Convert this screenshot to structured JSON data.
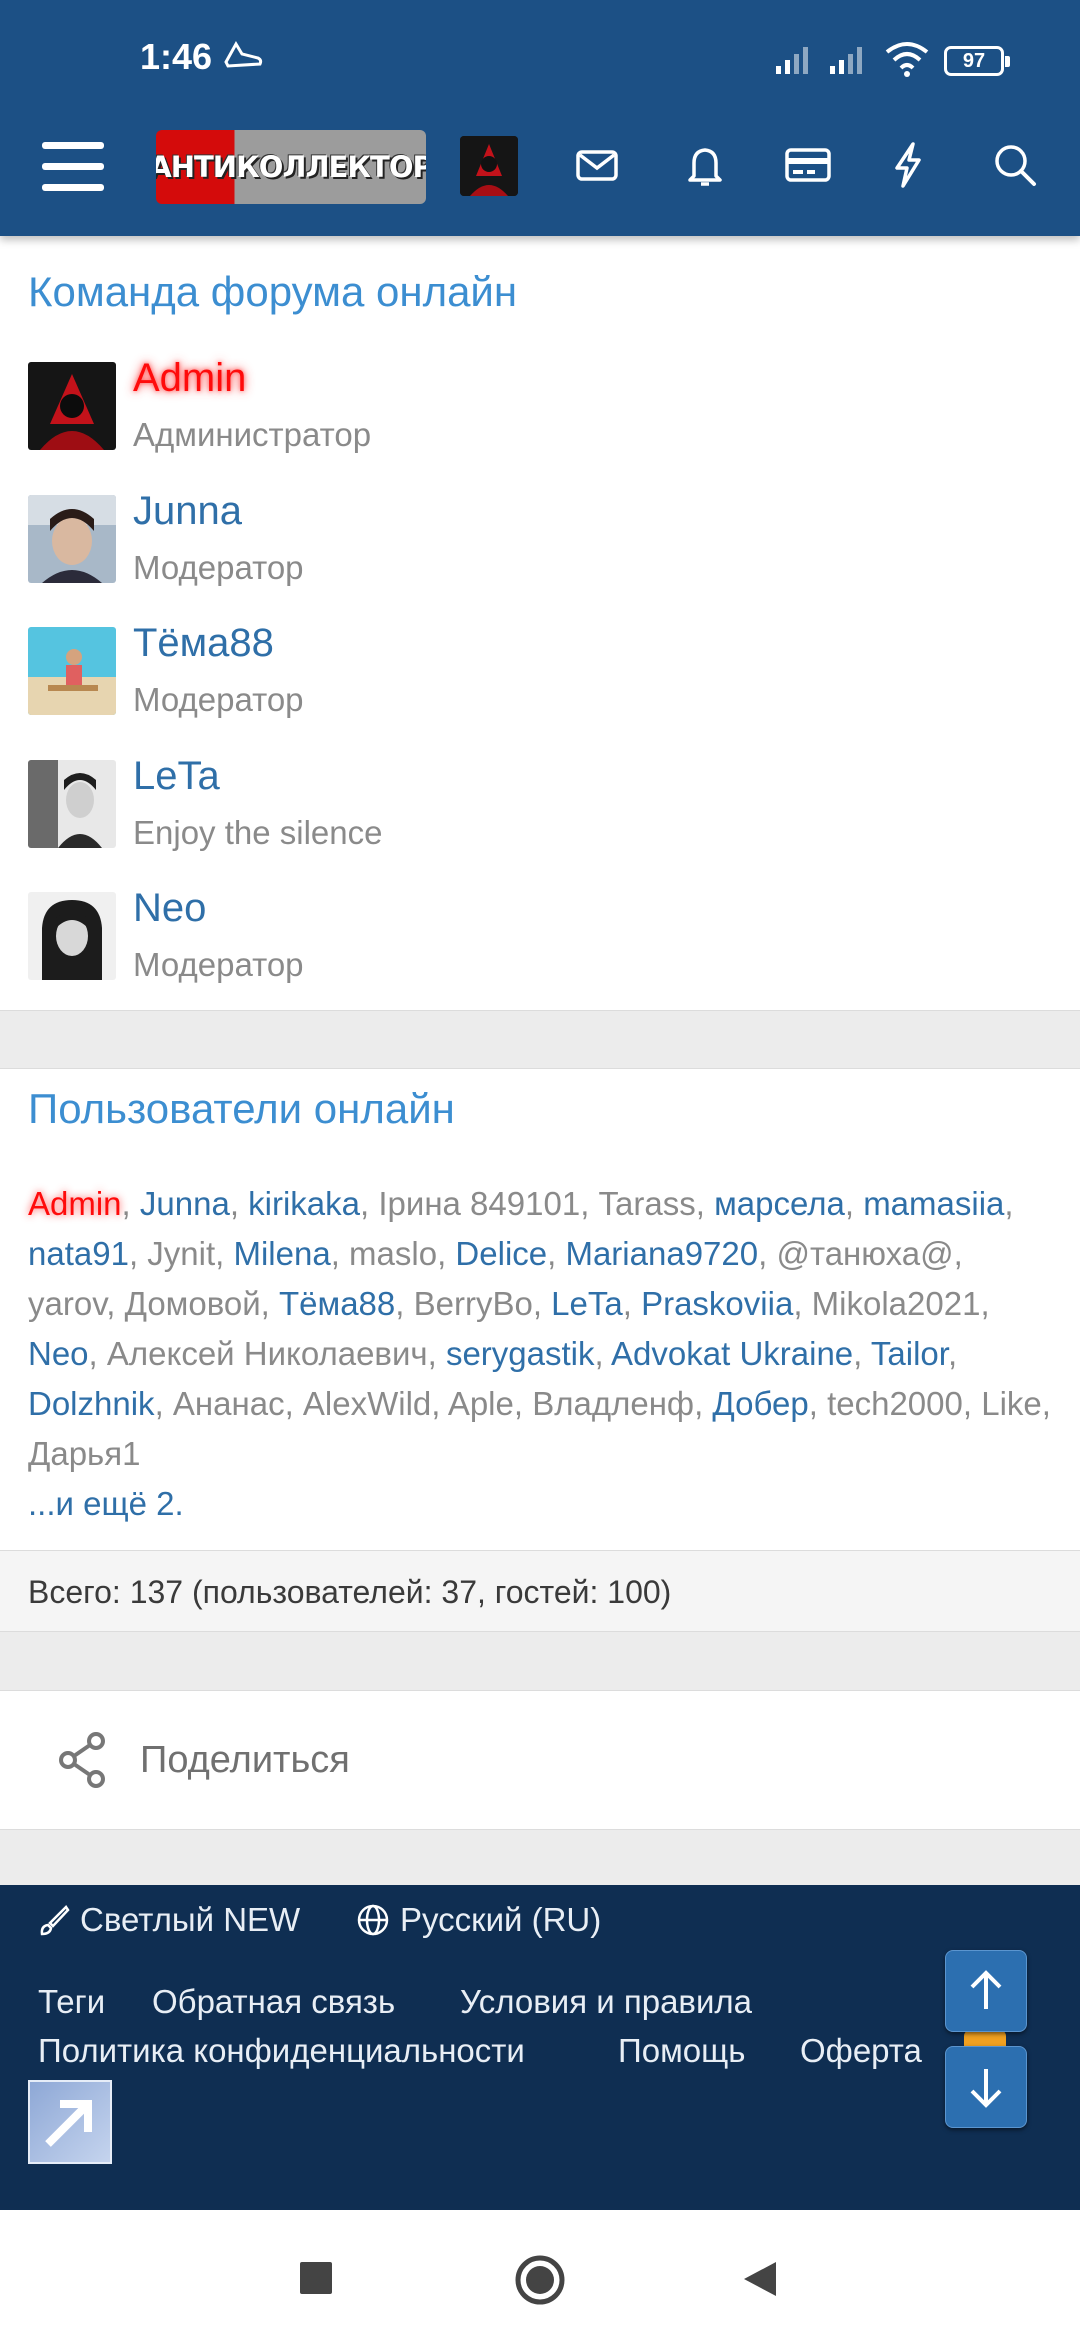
{
  "status_bar": {
    "time": "1:46",
    "battery": "97"
  },
  "header": {
    "logo_text": "АНТИКОЛЛЕКТОР",
    "icons": [
      "menu-icon",
      "mail-icon",
      "bell-icon",
      "card-icon",
      "bolt-icon",
      "search-icon"
    ]
  },
  "staff": {
    "title": "Команда форума онлайн",
    "members": [
      {
        "name": "Admin",
        "role": "Администратор"
      },
      {
        "name": "Junna",
        "role": "Модератор"
      },
      {
        "name": "Тёма88",
        "role": "Модератор"
      },
      {
        "name": "LeTa",
        "role": "Enjoy the silence"
      },
      {
        "name": "Neo",
        "role": "Модератор"
      }
    ]
  },
  "online": {
    "title": "Пользователи онлайн",
    "users": [
      {
        "name": "Admin",
        "type": "admin"
      },
      {
        "name": "Junna",
        "type": "member"
      },
      {
        "name": "kirikaka",
        "type": "member"
      },
      {
        "name": "Ірина 849101",
        "type": "guest"
      },
      {
        "name": "Tarass",
        "type": "guest"
      },
      {
        "name": "марсела",
        "type": "member"
      },
      {
        "name": "mamasiia",
        "type": "member"
      },
      {
        "name": "nata91",
        "type": "member"
      },
      {
        "name": "Jynit",
        "type": "guest"
      },
      {
        "name": "Milena",
        "type": "member"
      },
      {
        "name": "maslo",
        "type": "guest"
      },
      {
        "name": "Delice",
        "type": "member"
      },
      {
        "name": "Mariana9720",
        "type": "member"
      },
      {
        "name": "@танюха@",
        "type": "guest"
      },
      {
        "name": "yarov",
        "type": "guest"
      },
      {
        "name": "Домовой",
        "type": "guest"
      },
      {
        "name": "Тёма88",
        "type": "member"
      },
      {
        "name": "BerryBo",
        "type": "guest"
      },
      {
        "name": "LeTa",
        "type": "member"
      },
      {
        "name": "Praskoviia",
        "type": "member"
      },
      {
        "name": "Mikola2021",
        "type": "guest"
      },
      {
        "name": "Neo",
        "type": "member"
      },
      {
        "name": "Алексей Николаевич",
        "type": "guest"
      },
      {
        "name": "serygastik",
        "type": "member"
      },
      {
        "name": "Advokat Ukraine",
        "type": "member"
      },
      {
        "name": "Tailor",
        "type": "member"
      },
      {
        "name": "Dolzhnik",
        "type": "member"
      },
      {
        "name": "Ананас",
        "type": "guest"
      },
      {
        "name": "AlexWild",
        "type": "guest"
      },
      {
        "name": "Aple",
        "type": "guest"
      },
      {
        "name": "Владленф",
        "type": "guest"
      },
      {
        "name": "Добер",
        "type": "member"
      },
      {
        "name": "tech2000",
        "type": "guest"
      },
      {
        "name": "Like",
        "type": "guest"
      },
      {
        "name": "Дарья1",
        "type": "guest"
      }
    ],
    "more": "...и ещё 2.",
    "totals": "Всего: 137 (пользователей: 37, гостей: 100)"
  },
  "share": {
    "label": "Поделиться"
  },
  "footer": {
    "style_label": "Светлый NEW",
    "language_label": "Русский (RU)",
    "links_row1": [
      "Теги",
      "Обратная связь",
      "Условия и правила"
    ],
    "links_row2": [
      "Политика конфиденциальности",
      "Помощь",
      "Оферта"
    ]
  },
  "colors": {
    "header_bg": "#1c5085",
    "footer_bg": "#0f2e52",
    "link": "#2f6fa8",
    "title": "#3c8ed1",
    "admin": "#ff0b0b"
  }
}
